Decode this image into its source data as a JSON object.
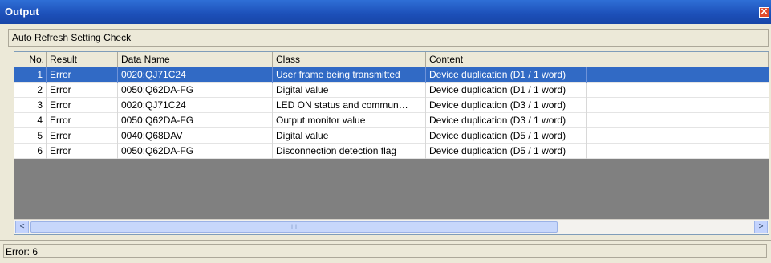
{
  "window": {
    "title": "Output",
    "close_glyph": "✕"
  },
  "subheader": "Auto Refresh Setting Check",
  "table": {
    "columns": [
      "No.",
      "Result",
      "Data Name",
      "Class",
      "Content"
    ],
    "rows": [
      {
        "no": "1",
        "result": "Error",
        "data_name": "0020:QJ71C24",
        "class": "User frame being transmitted",
        "content": "Device duplication (D1 / 1 word)",
        "selected": true
      },
      {
        "no": "2",
        "result": "Error",
        "data_name": "0050:Q62DA-FG",
        "class": "Digital value",
        "content": "Device duplication (D1 / 1 word)"
      },
      {
        "no": "3",
        "result": "Error",
        "data_name": "0020:QJ71C24",
        "class": "LED ON status and commun…",
        "content": "Device duplication (D3 / 1 word)"
      },
      {
        "no": "4",
        "result": "Error",
        "data_name": "0050:Q62DA-FG",
        "class": "Output monitor value",
        "content": "Device duplication (D3 / 1 word)"
      },
      {
        "no": "5",
        "result": "Error",
        "data_name": "0040:Q68DAV",
        "class": "Digital value",
        "content": "Device duplication (D5 / 1 word)"
      },
      {
        "no": "6",
        "result": "Error",
        "data_name": "0050:Q62DA-FG",
        "class": "Disconnection detection flag",
        "content": "Device duplication (D5 / 1 word)"
      }
    ]
  },
  "scrollbar": {
    "left_glyph": "<",
    "right_glyph": ">",
    "thumb_glyph": "III"
  },
  "status": "Error: 6",
  "colors": {
    "titlebar": "#1C4FB8",
    "selection": "#316AC5",
    "grid_empty": "#808080"
  }
}
